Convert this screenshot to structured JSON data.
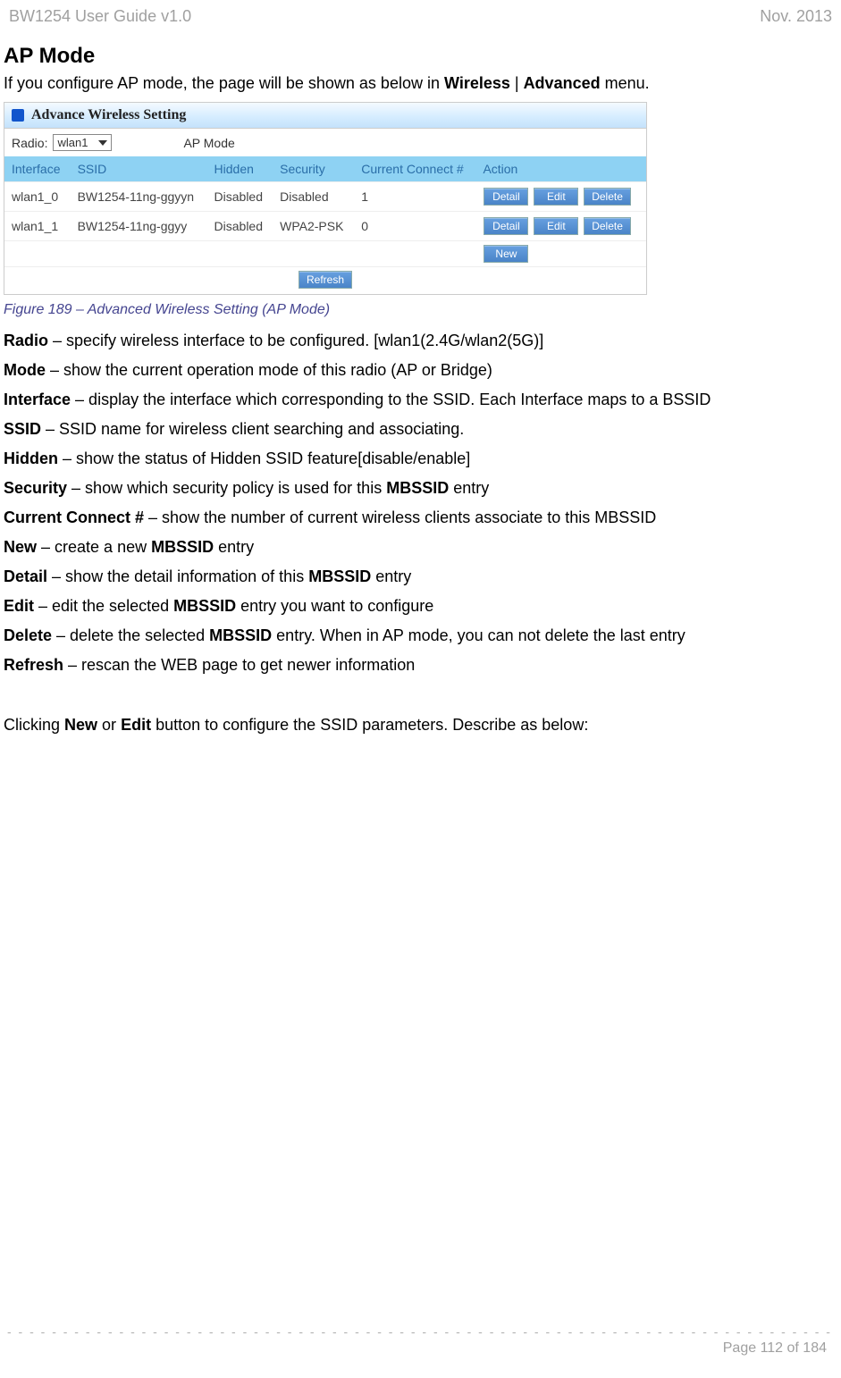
{
  "header": {
    "left": "BW1254 User Guide v1.0",
    "right": "Nov.  2013"
  },
  "title": "AP Mode",
  "intro": {
    "prefix": "If you configure AP mode, the page will be shown as below in ",
    "b1": "Wireless",
    "mid": " | ",
    "b2": "Advanced",
    "suffix": " menu."
  },
  "screenshot": {
    "titlebar": "Advance Wireless Setting",
    "radioLabel": "Radio:",
    "radioValue": "wlan1",
    "modeText": "AP Mode",
    "headers": {
      "interface": "Interface",
      "ssid": "SSID",
      "hidden": "Hidden",
      "security": "Security",
      "connect": "Current Connect #",
      "action": "Action"
    },
    "rows": [
      {
        "iface": "wlan1_0",
        "ssid": "BW1254-11ng-ggyyn",
        "hidden": "Disabled",
        "security": "Disabled",
        "conn": "1"
      },
      {
        "iface": "wlan1_1",
        "ssid": "BW1254-11ng-ggyy",
        "hidden": "Disabled",
        "security": "WPA2-PSK",
        "conn": "0"
      }
    ],
    "buttons": {
      "detail": "Detail",
      "edit": "Edit",
      "delete": "Delete",
      "new": "New",
      "refresh": "Refresh"
    }
  },
  "figcaption": "Figure 189 – Advanced Wireless Setting (AP Mode)",
  "defs": {
    "radio": {
      "term": "Radio",
      "desc": " – specify wireless interface to be configured. [wlan1(2.4G/wlan2(5G)]"
    },
    "mode": {
      "term": "Mode",
      "desc": " – show the current operation mode of this radio (AP or Bridge)"
    },
    "interface": {
      "term": "Interface",
      "desc": " – display the interface which corresponding to the SSID. Each Interface maps to a BSSID"
    },
    "ssid": {
      "term": "SSID",
      "desc": " – SSID name for wireless client searching and associating."
    },
    "hidden": {
      "term": "Hidden",
      "desc": " – show the status of Hidden SSID feature[disable/enable]"
    },
    "security": {
      "term": "Security",
      "mid": " – show which security policy is used for this ",
      "b2": "MBSSID",
      "suffix": " entry"
    },
    "conn": {
      "term": "Current Connect #",
      "desc": " – show the number of current wireless clients associate to  this MBSSID"
    },
    "new": {
      "term": "New",
      "mid": " – create a new ",
      "b2": "MBSSID",
      "suffix": " entry"
    },
    "detail": {
      "term": "Detail",
      "mid": " – show the detail information of this ",
      "b2": "MBSSID",
      "suffix": " entry"
    },
    "edit": {
      "term": "Edit",
      "mid": " – edit the selected ",
      "b2": "MBSSID",
      "suffix": " entry you want to configure"
    },
    "delete": {
      "term": "Delete",
      "mid": " – delete the selected ",
      "b2": "MBSSID",
      "suffix": " entry. When in AP mode, you can not delete the last entry"
    },
    "refresh": {
      "term": "Refresh",
      "desc": " – rescan the WEB page to get newer information"
    }
  },
  "follow": {
    "prefix": "Clicking ",
    "b1": "New",
    "mid": " or ",
    "b2": "Edit",
    "suffix": " button to configure the SSID parameters. Describe as below:"
  },
  "footer": {
    "page": "Page 112 of 184"
  }
}
